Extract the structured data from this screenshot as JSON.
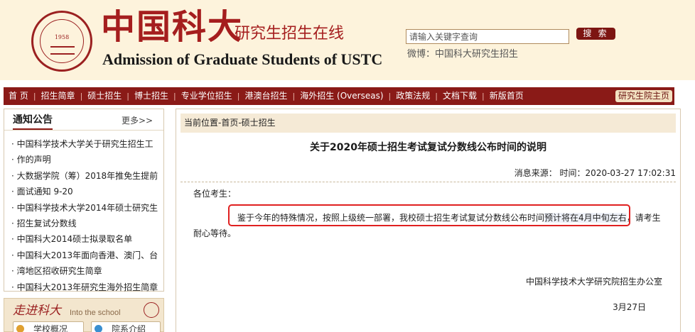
{
  "header": {
    "emblem_year": "1958",
    "logo_cn": "中国科大",
    "logo_sub": "研究生招生在线",
    "logo_en": "Admission of Graduate Students of USTC",
    "search_placeholder": "请输入关键字查询",
    "search_button": "搜 索",
    "weibo": "微博：中国科大研究生招生",
    "brand_color": "#a51e1e"
  },
  "nav": {
    "items": [
      "首 页",
      "招生简章",
      "硕士招生",
      "博士招生",
      "专业学位招生",
      "港澳台招生",
      "海外招生 (Overseas)",
      "政策法规",
      "文档下载",
      "新版首页"
    ],
    "right_link": "研究生院主页",
    "bar_color": "#8a1a17"
  },
  "notice": {
    "title": "通知公告",
    "more": "更多>>",
    "items": [
      "中国科学技术大学关于研究生招生工",
      "作的声明",
      "大数据学院（筹）2018年推免生提前",
      "面试通知 9-20",
      "中国科学技术大学2014年硕士研究生",
      "招生复试分数线",
      "中国科大2014硕士拟录取名单",
      "中国科大2013年面向香港、澳门、台",
      "湾地区招收研究生简章",
      "中国科大2013年研究生海外招生简章"
    ]
  },
  "intro": {
    "title": "走进科大",
    "subtitle": "Into the school",
    "school_button": "学校概况",
    "contact_button": "院系介绍"
  },
  "article": {
    "breadcrumb": "当前位置-首页-硕士招生",
    "title": "关于2020年硕士招生考试复试分数线公布时间的说明",
    "meta": "消息来源： 时间：2020-03-27 17:02:31",
    "greeting": "各位考生：",
    "para_main": "鉴于今年的特殊情况，按照上级统一部署，我校硕士招生考试复试分数线公布时间",
    "para_highlight": "预计将在4月中旬左右",
    "para_tail": "，请考生",
    "para_cont": "耐心等待。",
    "signature_org": "中国科学技术大学研究院招生办公室",
    "signature_date": "3月27日"
  }
}
